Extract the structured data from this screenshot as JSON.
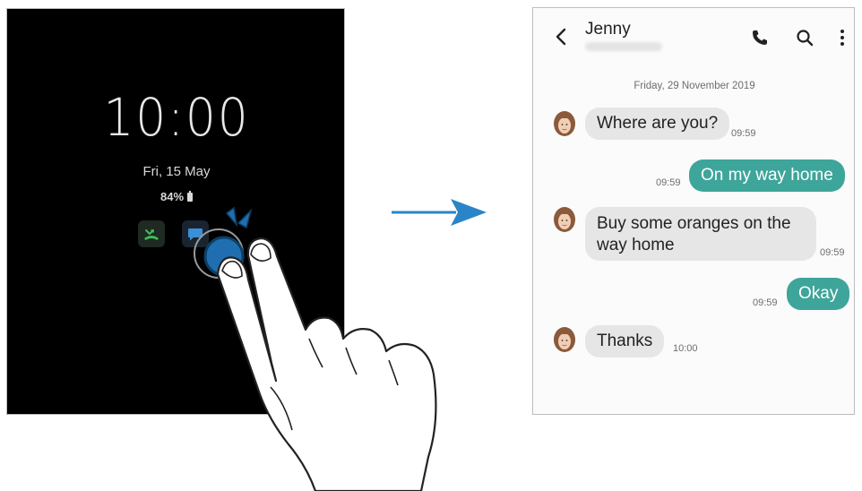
{
  "aod": {
    "time": "10:00",
    "date": "Fri, 15 May",
    "battery": "84%",
    "notifications": [
      {
        "icon": "missed-call-icon",
        "color": "#3fbf5a"
      },
      {
        "icon": "message-icon",
        "color": "#3a8fd6"
      }
    ]
  },
  "arrow": {
    "icon": "right-arrow-icon",
    "color": "#2a85c8"
  },
  "conversation": {
    "contact_name": "Jenny",
    "header_icons": [
      "back-arrow-icon",
      "phone-icon",
      "search-icon",
      "more-vertical-icon"
    ],
    "date_separator": "Friday, 29 November 2019",
    "accent_color": "#3ea59a",
    "messages": [
      {
        "direction": "incoming",
        "text": "Where are you?",
        "time": "09:59"
      },
      {
        "direction": "outgoing",
        "text": "On my way home",
        "time": "09:59"
      },
      {
        "direction": "incoming",
        "text": "Buy some oranges on the way home",
        "time": "09:59"
      },
      {
        "direction": "outgoing",
        "text": "Okay",
        "time": "09:59"
      },
      {
        "direction": "incoming",
        "text": "Thanks",
        "time": "10:00"
      }
    ]
  },
  "gesture": {
    "icon": "double-tap-hand-icon",
    "highlight_color": "#1f6fb0"
  }
}
